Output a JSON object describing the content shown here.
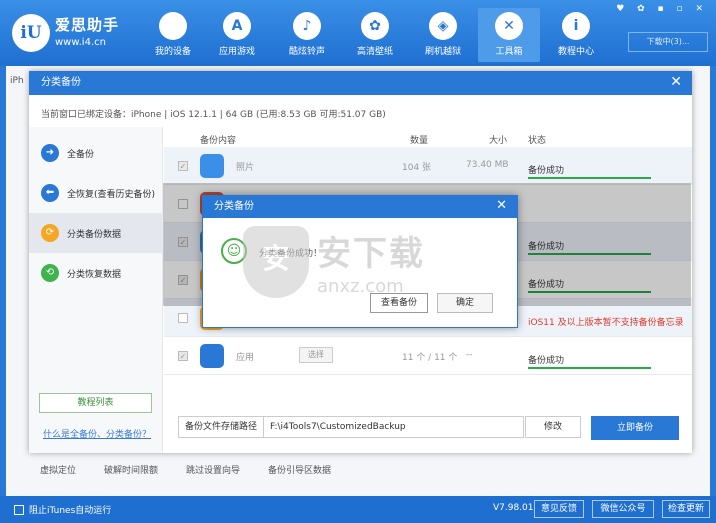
{
  "app": {
    "brand_name": "爱思助手",
    "brand_url": "www.i4.cn",
    "logo_text": "iU",
    "window_controls": "♥ ✿ ▪ ▫ ✕",
    "download_label": "下载中(3)..."
  },
  "nav": [
    {
      "label": "我的设备",
      "icon": "apple-icon",
      "glyph": ""
    },
    {
      "label": "应用游戏",
      "icon": "appstore-icon",
      "glyph": "A"
    },
    {
      "label": "酷炫铃声",
      "icon": "bell-icon",
      "glyph": "♪"
    },
    {
      "label": "高清壁纸",
      "icon": "flower-icon",
      "glyph": "✿"
    },
    {
      "label": "刷机越狱",
      "icon": "box-icon",
      "glyph": "◈"
    },
    {
      "label": "工具箱",
      "icon": "tools-icon",
      "glyph": "✕"
    },
    {
      "label": "教程中心",
      "icon": "info-icon",
      "glyph": "i"
    }
  ],
  "background": {
    "tab_label": "iPh",
    "links": [
      "虚拟定位",
      "破解时间限额",
      "跳过设置向导",
      "备份引导区数据"
    ]
  },
  "statusbar": {
    "itunes_label": "阻止iTunes自动运行",
    "version": "V7.98.01",
    "feedback": "意见反馈",
    "wechat": "微信公众号",
    "update": "检查更新"
  },
  "dialog": {
    "title": "分类备份",
    "close": "✕",
    "device_info": "当前窗口已绑定设备：iPhone  |  iOS 12.1.1  |  64 GB (已用:8.53 GB 可用:51.07 GB)",
    "sidebar": [
      {
        "label": "全备份",
        "icon": "arrow-right-icon",
        "glyph": "➜",
        "color": "#2a78d6"
      },
      {
        "label": "全恢复(查看历史备份)",
        "icon": "arrow-left-icon",
        "glyph": "⬅",
        "color": "#2a78d6"
      },
      {
        "label": "分类备份数据",
        "icon": "category-backup-icon",
        "glyph": "⟳",
        "color": "#f5a623"
      },
      {
        "label": "分类恢复数据",
        "icon": "category-restore-icon",
        "glyph": "⟲",
        "color": "#3fb34f"
      }
    ],
    "tutorial_btn": "教程列表",
    "whatis_link": "什么是全备份、分类备份？",
    "columns": {
      "content": "备份内容",
      "count": "数量",
      "size": "大小",
      "status": "状态"
    },
    "rows": [
      {
        "name": "照片",
        "count": "104 张",
        "size": "73.40 MB",
        "status": "备份成功",
        "color": "#3b8fe6",
        "icon": "photos-icon",
        "has_select": false
      },
      {
        "name": "",
        "count": "",
        "size": "",
        "status": "",
        "color": "#e35a3b",
        "icon": "app-icon",
        "has_select": false
      },
      {
        "name": "",
        "count": "",
        "size": "",
        "status": "备份成功",
        "color": "#3b8fe6",
        "icon": "app-icon",
        "has_select": false
      },
      {
        "name": "",
        "count": "",
        "size": "",
        "status": "备份成功",
        "color": "#f5a623",
        "icon": "app-icon",
        "has_select": false
      },
      {
        "name": "",
        "count": "",
        "size": "",
        "status": "iOS11 及以上版本暂不支持备份备忘录",
        "color": "#f5a623",
        "icon": "notes-icon",
        "has_select": false
      },
      {
        "name": "应用",
        "count": "11 个 / 11 个",
        "size": "--",
        "status": "备份成功",
        "color": "#2a78d6",
        "icon": "appstore-icon",
        "has_select": true,
        "select_label": "选择"
      }
    ],
    "path_label": "备份文件存储路径",
    "path_value": "F:\\i4Tools7\\CustomizedBackup",
    "modify_btn": "修改",
    "backup_now_btn": "立即备份"
  },
  "popup": {
    "title": "分类备份",
    "close": "✕",
    "message": "分类备份成功！",
    "view_btn": "查看备份",
    "ok_btn": "确定"
  },
  "watermark": {
    "cn": "安下载",
    "en": "anxz.com",
    "shield": "安"
  }
}
